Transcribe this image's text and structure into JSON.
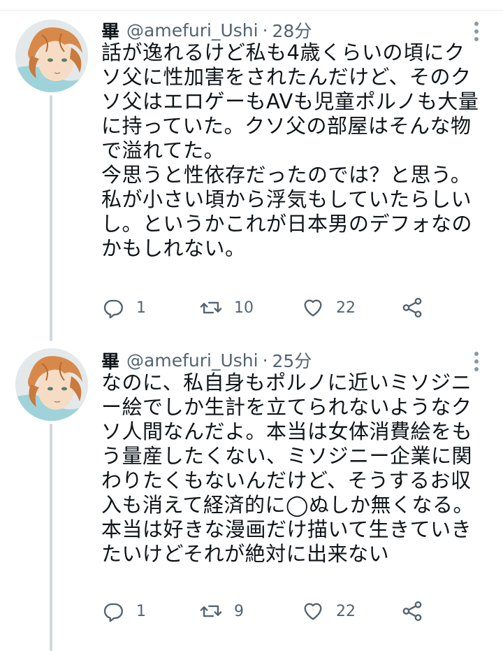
{
  "tweets": [
    {
      "display_name": "畢",
      "handle": "@amefuri_Ushi",
      "separator": "·",
      "time": "28分",
      "text": "話が逸れるけど私も4歳くらいの頃にクソ父に性加害をされたんだけど、そのクソ父はエロゲーもAVも児童ポルノも大量に持っていた。クソ父の部屋はそんな物で溢れてた。\n今思うと性依存だったのでは？と思う。私が小さい頃から浮気もしていたらしいし。というかこれが日本男のデフォなのかもしれない。",
      "replies": "1",
      "retweets": "10",
      "likes": "22"
    },
    {
      "display_name": "畢",
      "handle": "@amefuri_Ushi",
      "separator": "·",
      "time": "25分",
      "text": "なのに、私自身もポルノに近いミソジニー絵でしか生計を立てられないようなクソ人間なんだよ。本当は女体消費絵をもう量産したくない、ミソジニー企業に関わりたくもないんだけど、そうするお収入も消えて経済的に◯ぬしか無くなる。本当は好きな漫画だけ描いて生きていきたいけどそれが絶対に出来ない",
      "replies": "1",
      "retweets": "9",
      "likes": "22"
    }
  ],
  "icons": {
    "reply": "reply-icon",
    "retweet": "retweet-icon",
    "like": "heart-icon",
    "share": "share-icon",
    "more": "more-vertical-icon"
  },
  "colors": {
    "text": "#0f1419",
    "secondary": "#536471",
    "thread_line": "#cfd9de",
    "icon": "#536471"
  }
}
